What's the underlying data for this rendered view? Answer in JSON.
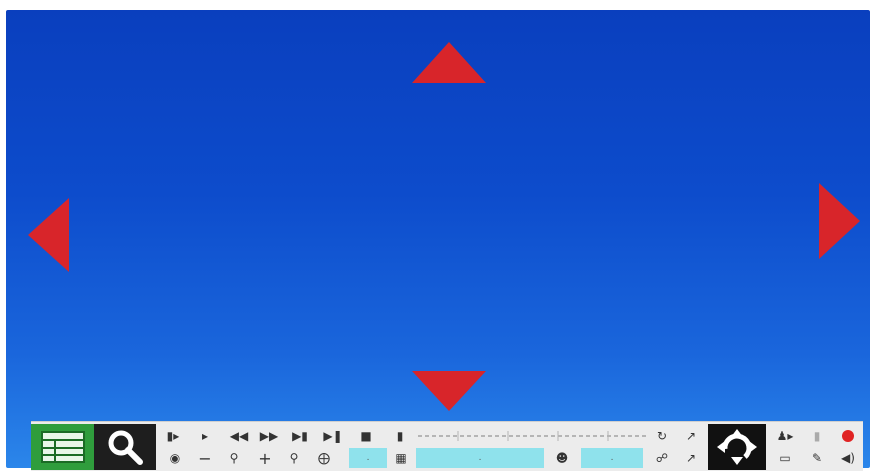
{
  "colors": {
    "background_top": "#0a3fbe",
    "background_bottom": "#2b86ea",
    "arrow": "#d8252a",
    "toolbar": "#ececec",
    "menu_button": "#2f9d3c",
    "dark_button": "#1e1e1e",
    "field": "#8fe2ec",
    "record": "#e02323"
  },
  "direction_arrows": [
    "arrow-up-icon",
    "arrow-down-icon",
    "arrow-left-icon",
    "arrow-right-icon"
  ],
  "toolbar": {
    "row1_icons": [
      "split-icon",
      "play-slow-icon",
      "rewind-icon",
      "fast-forward-icon",
      "next-frame-icon",
      "play-pause-icon",
      "stop-icon",
      "folder-icon",
      "timeline-icon",
      "sync-icon",
      "export-icon"
    ],
    "row2_icons": [
      "camera-icon",
      "minus-icon",
      "zoom-out-icon",
      "plus-icon",
      "zoom-in-icon",
      "grid-icon",
      "calendar-icon",
      "person-icon",
      "cart-icon",
      "export-icon"
    ],
    "field_values": [
      ".",
      ".",
      "."
    ],
    "right_icons": [
      "user-play-icon",
      "stats-icon",
      "record-icon",
      "screen-icon",
      "edit-icon",
      "volume-icon"
    ]
  }
}
